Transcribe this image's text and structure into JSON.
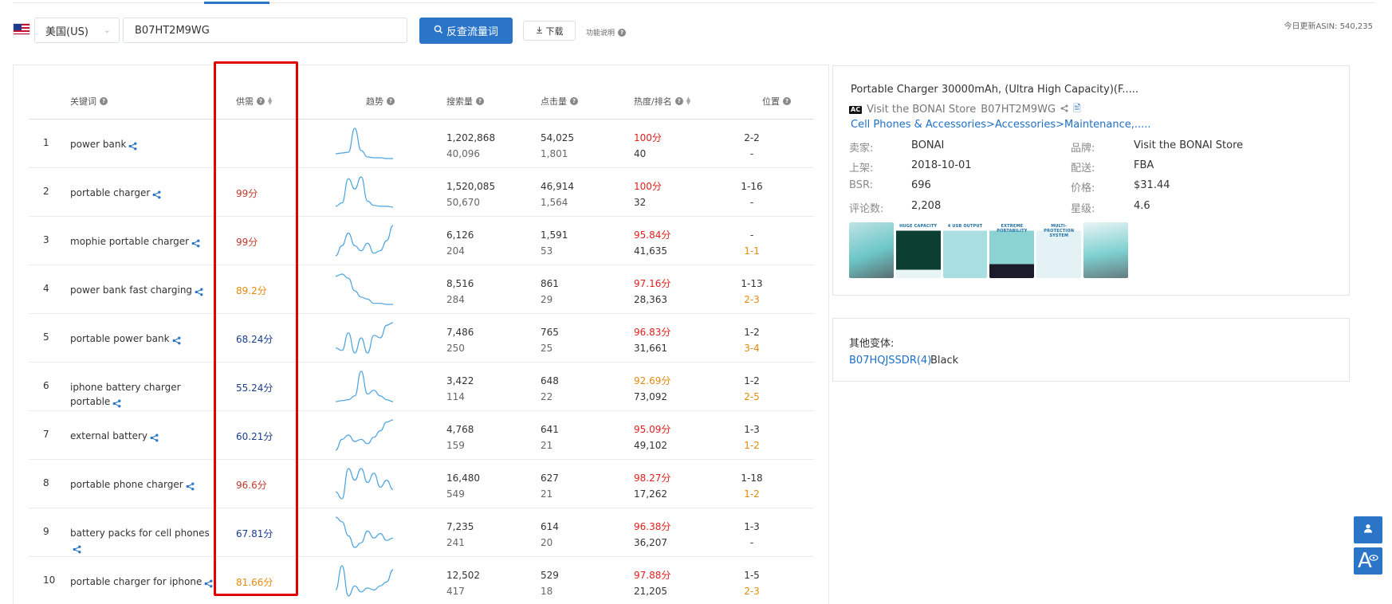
{
  "toolbar": {
    "country": "美国(US)",
    "asin": "B07HT2M9WG",
    "search_button": "反查流量词",
    "download_button": "下载",
    "help_label": "功能说明",
    "update_info": "今日更新ASIN: 540,235"
  },
  "table": {
    "headers": {
      "keyword": "关键词",
      "supply": "供需",
      "trend": "趋势",
      "search_volume": "搜索量",
      "clicks": "点击量",
      "heat_rank": "热度/排名",
      "position": "位置"
    },
    "rows": [
      {
        "idx": "1",
        "keyword": "power bank",
        "supply": "",
        "supply_color": "#c0392b",
        "search": "1,202,868",
        "search_sub": "40,096",
        "clicks": "54,025",
        "clicks_sub": "1,801",
        "heat": "100分",
        "heat_color": "#e0201e",
        "rank": "40",
        "pos": "2-2",
        "pos_sub": "-",
        "pos_sub_color": "#333333",
        "trend": [
          8,
          9,
          10,
          40,
          12,
          4,
          3,
          3,
          2,
          2
        ]
      },
      {
        "idx": "2",
        "keyword": "portable charger",
        "supply": "99分",
        "supply_color": "#c0392b",
        "search": "1,520,085",
        "search_sub": "50,670",
        "clicks": "46,914",
        "clicks_sub": "1,564",
        "heat": "100分",
        "heat_color": "#e0201e",
        "rank": "32",
        "pos": "1-16",
        "pos_sub": "-",
        "pos_sub_color": "#333333",
        "trend": [
          2,
          6,
          34,
          22,
          36,
          8,
          3,
          2,
          2,
          1
        ]
      },
      {
        "idx": "3",
        "keyword": "mophie portable charger",
        "supply": "99分",
        "supply_color": "#c0392b",
        "search": "6,126",
        "search_sub": "204",
        "clicks": "1,591",
        "clicks_sub": "53",
        "heat": "95.84分",
        "heat_color": "#e0201e",
        "rank": "41,635",
        "pos": "-",
        "pos_sub": "1-1",
        "pos_sub_color": "#e5890a",
        "trend": [
          6,
          14,
          24,
          14,
          10,
          16,
          8,
          10,
          18,
          30
        ]
      },
      {
        "idx": "4",
        "keyword": "power bank fast charging",
        "supply": "89.2分",
        "supply_color": "#e5890a",
        "search": "8,516",
        "search_sub": "284",
        "clicks": "861",
        "clicks_sub": "29",
        "heat": "97.16分",
        "heat_color": "#e0201e",
        "rank": "28,363",
        "pos": "1-13",
        "pos_sub": "2-3",
        "pos_sub_color": "#e5890a",
        "trend": [
          30,
          32,
          28,
          16,
          10,
          8,
          4,
          4,
          3,
          3
        ]
      },
      {
        "idx": "5",
        "keyword": "portable power bank",
        "supply": "68.24分",
        "supply_color": "#1a3d8f",
        "search": "7,486",
        "search_sub": "250",
        "clicks": "765",
        "clicks_sub": "25",
        "heat": "96.83分",
        "heat_color": "#e0201e",
        "rank": "31,661",
        "pos": "1-2",
        "pos_sub": "3-4",
        "pos_sub_color": "#e5890a",
        "trend": [
          10,
          8,
          22,
          6,
          18,
          6,
          20,
          18,
          28,
          30
        ]
      },
      {
        "idx": "6",
        "keyword": "iphone battery charger portable",
        "supply": "55.24分",
        "supply_color": "#1a3d8f",
        "search": "3,422",
        "search_sub": "114",
        "clicks": "648",
        "clicks_sub": "22",
        "heat": "92.69分",
        "heat_color": "#e5890a",
        "rank": "73,092",
        "pos": "1-2",
        "pos_sub": "2-5",
        "pos_sub_color": "#e5890a",
        "trend": [
          4,
          5,
          6,
          10,
          36,
          12,
          16,
          10,
          6,
          4
        ]
      },
      {
        "idx": "7",
        "keyword": "external battery",
        "supply": "60.21分",
        "supply_color": "#1a3d8f",
        "search": "4,768",
        "search_sub": "159",
        "clicks": "641",
        "clicks_sub": "21",
        "heat": "95.09分",
        "heat_color": "#e0201e",
        "rank": "49,102",
        "pos": "1-3",
        "pos_sub": "1-2",
        "pos_sub_color": "#e5890a",
        "trend": [
          4,
          14,
          18,
          12,
          14,
          10,
          16,
          22,
          30,
          32
        ]
      },
      {
        "idx": "8",
        "keyword": "portable phone charger",
        "supply": "96.6分",
        "supply_color": "#c0392b",
        "search": "16,480",
        "search_sub": "549",
        "clicks": "627",
        "clicks_sub": "21",
        "heat": "98.27分",
        "heat_color": "#e0201e",
        "rank": "17,262",
        "pos": "1-18",
        "pos_sub": "1-2",
        "pos_sub_color": "#e5890a",
        "trend": [
          10,
          4,
          30,
          20,
          30,
          18,
          26,
          14,
          20,
          12
        ]
      },
      {
        "idx": "9",
        "keyword": "battery packs for cell phones",
        "supply": "67.81分",
        "supply_color": "#1a3d8f",
        "search": "7,235",
        "search_sub": "241",
        "clicks": "614",
        "clicks_sub": "20",
        "heat": "96.38分",
        "heat_color": "#e0201e",
        "rank": "36,207",
        "pos": "1-3",
        "pos_sub": "-",
        "pos_sub_color": "#333333",
        "trend": [
          30,
          26,
          14,
          4,
          8,
          18,
          12,
          16,
          10,
          12
        ]
      },
      {
        "idx": "10",
        "keyword": "portable charger for iphone",
        "supply": "81.66分",
        "supply_color": "#e5890a",
        "search": "12,502",
        "search_sub": "417",
        "clicks": "529",
        "clicks_sub": "18",
        "heat": "97.88分",
        "heat_color": "#e0201e",
        "rank": "21,205",
        "pos": "1-5",
        "pos_sub": "2-3",
        "pos_sub_color": "#e5890a",
        "trend": [
          10,
          34,
          4,
          14,
          8,
          12,
          10,
          14,
          18,
          30
        ]
      }
    ]
  },
  "product": {
    "title": "Portable Charger 30000mAh, (Ultra High Capacity)(F.....",
    "badge": "AC",
    "store": "Visit the BONAI Store",
    "asin": "B07HT2M9WG",
    "category": "Cell Phones & Accessories>Accessories>Maintenance,.....",
    "fields_left": [
      {
        "label": "卖家:",
        "value": "BONAI"
      },
      {
        "label": "上架:",
        "value": "2018-10-01"
      },
      {
        "label": "BSR:",
        "value": "696"
      },
      {
        "label": "评论数:",
        "value": "2,208"
      }
    ],
    "fields_right": [
      {
        "label": "品牌:",
        "value": "Visit the BONAI Store"
      },
      {
        "label": "配送:",
        "value": "FBA"
      },
      {
        "label": "价格:",
        "value": "$31.44"
      },
      {
        "label": "星级:",
        "value": "4.6"
      }
    ],
    "gallery_labels": [
      "",
      "HUGE CAPACITY",
      "4 USB OUTPUT",
      "EXTREME PORTABILITY",
      "MULTI-PROTECTION SYSTEM",
      ""
    ]
  },
  "variants": {
    "label": "其他变体:",
    "link": "B07HQJSSDR(4)",
    "color": "Black"
  },
  "colors": {
    "accent": "#2a75c7",
    "trend_line": "#4aa3e0",
    "highlight": "#e00000"
  }
}
